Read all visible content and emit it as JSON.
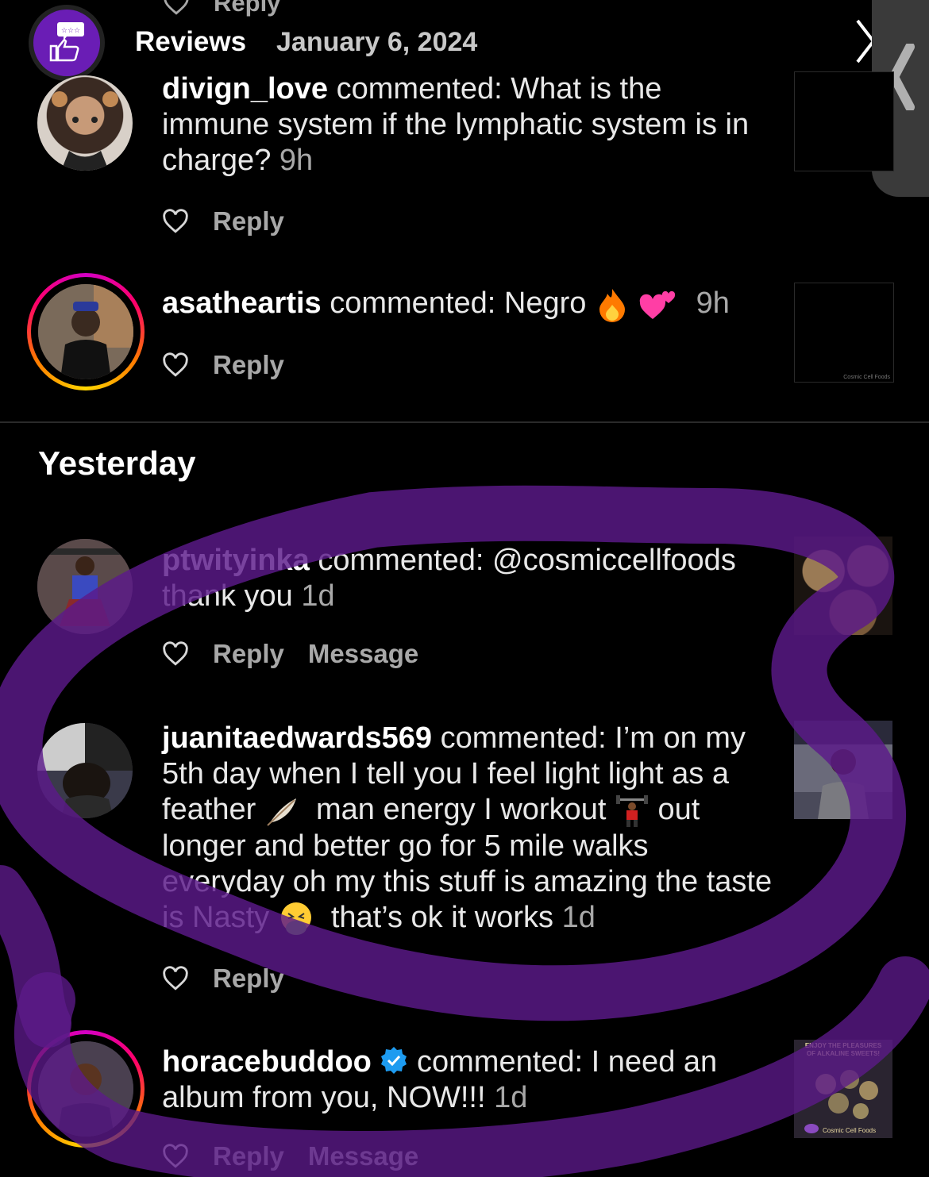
{
  "top_cut": {
    "reply": "Reply"
  },
  "header": {
    "title": "Reviews",
    "date": "January 6, 2024"
  },
  "comments": [
    {
      "username": "divign_love",
      "verb": " commented: ",
      "text": "What is the immune system if the lymphatic system is in charge?",
      "time": "9h",
      "reply": "Reply"
    },
    {
      "username": "asatheartis",
      "verb": " commented: ",
      "text": "Negro",
      "time": "9h",
      "reply": "Reply"
    },
    {
      "username": "ptwityinka",
      "verb": " commented: ",
      "text": "@cosmiccellfoods thank you",
      "time": "1d",
      "reply": "Reply",
      "message": "Message"
    },
    {
      "username": "juanitaedwards569",
      "verb": " commented: ",
      "text_a": "I’m on my 5th day when I tell you I feel light light as a feather",
      "text_b": "man energy I workout",
      "text_c": "out longer and better go for 5 mile walks everyday oh my this stuff is amazing the taste is Nasty",
      "text_d": "that’s ok it works",
      "time": "1d",
      "reply": "Reply"
    },
    {
      "username": "horacebuddoo",
      "verb": " commented: ",
      "text": "I need an album from you, NOW!!!",
      "time": "1d",
      "reply": "Reply",
      "message": "Message"
    }
  ],
  "section": {
    "yesterday": "Yesterday"
  },
  "thumbnails": {
    "asatheartis_caption": "Cosmic Cell Foods",
    "horace_line1": "ENJOY THE PLEASURES",
    "horace_line2": "OF ALKALINE SWEETS!",
    "horace_brand": "Cosmic Cell Foods"
  },
  "colors": {
    "background": "#000000",
    "secondary_text": "#a8a8a8",
    "scribble": "#5c1a8a",
    "verified": "#1d9bf0"
  }
}
